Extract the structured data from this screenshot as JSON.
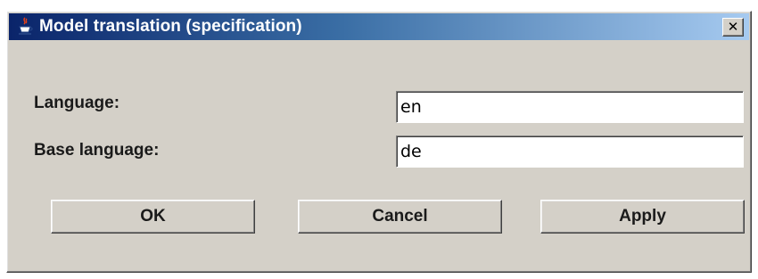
{
  "window": {
    "title": "Model translation (specification)",
    "close_glyph": "✕",
    "icon": "java-cup-icon"
  },
  "form": {
    "language_label": "Language:",
    "language_value": "en",
    "base_language_label": "Base language:",
    "base_language_value": "de"
  },
  "buttons": {
    "ok_label": "OK",
    "cancel_label": "Cancel",
    "apply_label": "Apply"
  },
  "colors": {
    "titlebar_start": "#0a246a",
    "titlebar_end": "#a6caf0",
    "dialog_background": "#d4d0c8"
  }
}
